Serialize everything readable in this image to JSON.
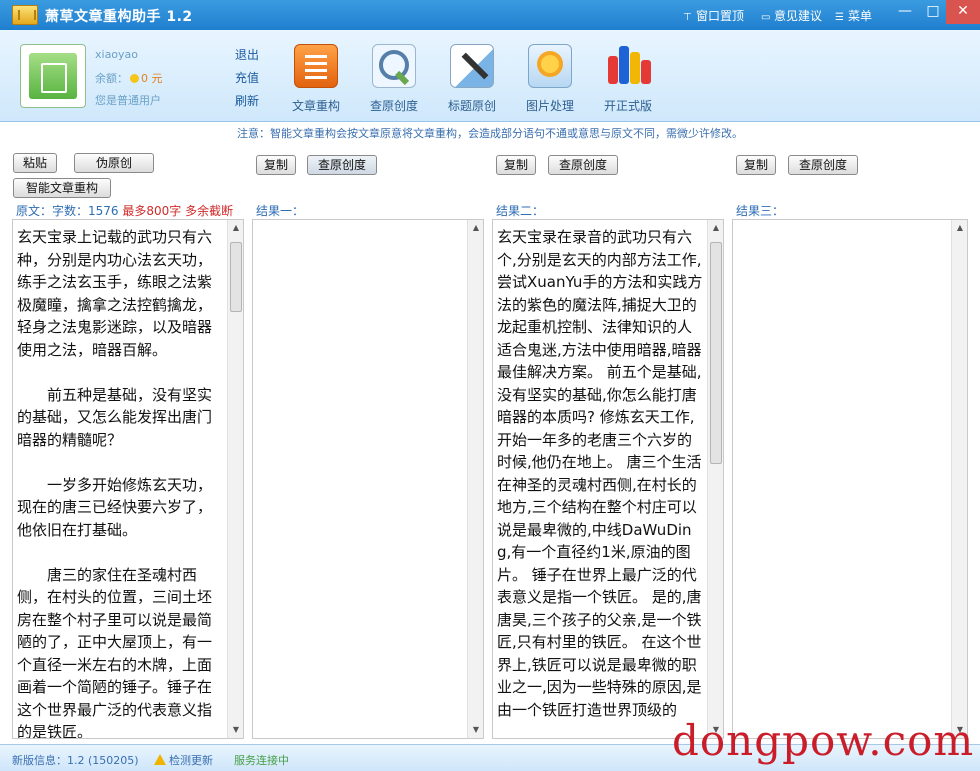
{
  "window": {
    "title": "萧草文章重构助手 1.2",
    "menu": [
      {
        "icon": "pin-icon",
        "label": "窗口置顶"
      },
      {
        "icon": "feedback-icon",
        "label": "意见建议"
      },
      {
        "icon": "menu-icon",
        "label": "菜单"
      }
    ],
    "controls": {
      "minimize": "—",
      "maximize": "□",
      "close": "✕"
    }
  },
  "account": {
    "username": "xiaoyao",
    "balance_label": "余额：",
    "balance_value": "0 元",
    "membership": "您是普通用户",
    "links": [
      "退出",
      "充值",
      "刷新"
    ]
  },
  "toolbar": {
    "tools": [
      {
        "name": "rewrite",
        "label": "文章重构"
      },
      {
        "name": "check",
        "label": "查原创度"
      },
      {
        "name": "title",
        "label": "标题原创"
      },
      {
        "name": "image",
        "label": "图片处理"
      },
      {
        "name": "publish",
        "label": "开正式版"
      }
    ]
  },
  "notice": "注意：智能文章重构会按文章原意将文章重构，会造成部分语句不通或意思与原文不同，需微少许修改。",
  "source": {
    "paste_button": "粘贴",
    "pseudo_button": "伪原创",
    "smart_button": "智能文章重构",
    "label_prefix": "原文：",
    "label_count": "字数：1576",
    "label_limit": "最多800字 多余截断",
    "text": "玄天宝录上记载的武功只有六种，分别是内功心法玄天功，练手之法玄玉手，练眼之法紫极魔瞳，擒拿之法控鹤擒龙，轻身之法鬼影迷踪，以及暗器使用之法，暗器百解。\n\n　　前五种是基础，没有坚实的基础，又怎么能发挥出唐门暗器的精髓呢？\n\n　　一岁多开始修炼玄天功，现在的唐三已经快要六岁了，他依旧在打基础。\n\n　　唐三的家住在圣魂村西侧，在村头的位置，三间土坯房在整个村子里可以说是最简陋的了，正中大屋顶上，有一个直径一米左右的木牌，上面画着一个简陋的锤子。锤子在这个世界最广泛的代表意义指的是铁匠。"
  },
  "results": [
    {
      "label": "结果一：",
      "copy": "复制",
      "check": "查原创度",
      "text": ""
    },
    {
      "label": "结果二：",
      "copy": "复制",
      "check": "查原创度",
      "text": "玄天宝录在录音的武功只有六个,分别是玄天的内部方法工作,尝试XuanYu手的方法和实践方法的紫色的魔法阵,捕捉大卫的龙起重机控制、法律知识的人适合鬼迷,方法中使用暗器,暗器最佳解决方案。 前五个是基础,没有坚实的基础,你怎么能打唐暗器的本质吗? 修炼玄天工作,开始一年多的老唐三个六岁的时候,他仍在地上。 唐三个生活在神圣的灵魂村西侧,在村长的地方,三个结构在整个村庄可以说是最卑微的,中线DaWuDing,有一个直径约1米,原油的图片。 锤子在世界上最广泛的代表意义是指一个铁匠。 是的,唐唐昊,三个孩子的父亲,是一个铁匠,只有村里的铁匠。 在这个世界上,铁匠可以说是最卑微的职业之一,因为一些特殊的原因,是由一个铁匠打造世界顶级的"
    },
    {
      "label": "结果三：",
      "copy": "复制",
      "check": "查原创度",
      "text": ""
    }
  ],
  "status": {
    "version": "新版信息：1.2 (150205)",
    "warning": "检测更新",
    "connection": "服务连接中"
  },
  "watermark": "dongpow.com"
}
